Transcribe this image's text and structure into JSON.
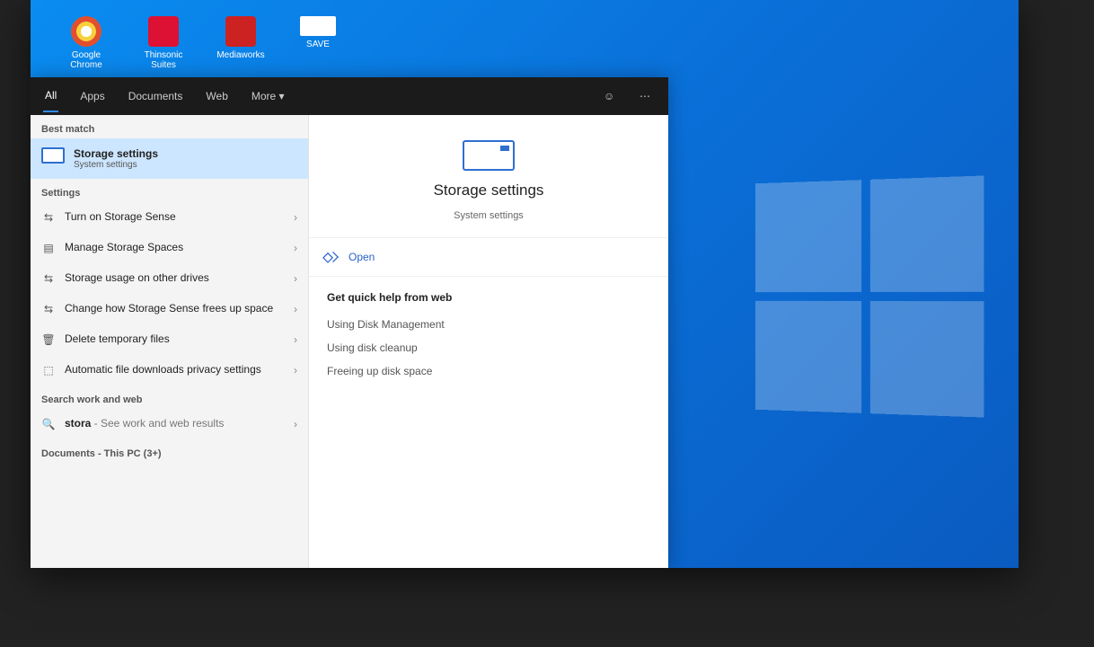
{
  "desktop": {
    "icons": [
      {
        "name": "google-chrome",
        "label": "Google Chrome",
        "ico": "chrome"
      },
      {
        "name": "thinsonic",
        "label": "Thinsonic Suites",
        "ico": "red"
      },
      {
        "name": "mediaworks",
        "label": "Mediaworks",
        "ico": "red2"
      },
      {
        "name": "save",
        "label": "SAVE",
        "ico": "white"
      }
    ]
  },
  "search": {
    "tabs": {
      "all": "All",
      "apps": "Apps",
      "documents": "Documents",
      "web": "Web",
      "more": "More ▾"
    },
    "groups": {
      "best_match": "Best match",
      "settings": "Settings",
      "search_work_web": "Search work and web",
      "documents_this_pc": "Documents - This PC (3+)"
    },
    "best": {
      "title": "Storage settings",
      "sub": "System settings"
    },
    "settings_list": [
      {
        "icon": "⇆",
        "label": "Turn on Storage Sense"
      },
      {
        "icon": "▤",
        "label": "Manage Storage Spaces"
      },
      {
        "icon": "⇆",
        "label": "Storage usage on other drives"
      },
      {
        "icon": "⇆",
        "label": "Change how Storage Sense frees up space"
      },
      {
        "icon": "🗑",
        "label": "Delete temporary files"
      },
      {
        "icon": "⬚",
        "label": "Automatic file downloads privacy settings"
      }
    ],
    "web": {
      "query": "stora",
      "hint": " - See work and web results"
    }
  },
  "preview": {
    "title": "Storage settings",
    "sub": "System settings",
    "open": "Open",
    "quick_header": "Get quick help from web",
    "quick_links": [
      "Using Disk Management",
      "Using disk cleanup",
      "Freeing up disk space"
    ]
  }
}
